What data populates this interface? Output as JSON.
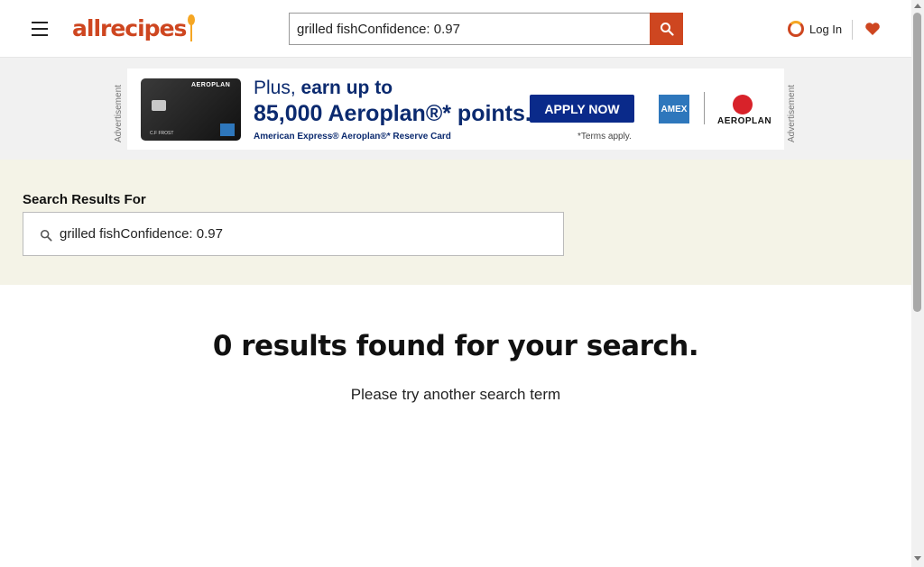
{
  "header": {
    "logo_text": "allrecipes",
    "search": {
      "value": "grilled fishConfidence: 0.97",
      "placeholder": ""
    },
    "login_label": "Log In",
    "icons": {
      "menu": "hamburger-menu-icon",
      "search": "search-icon",
      "account": "user-icon",
      "favorites": "heart-icon"
    }
  },
  "ad": {
    "label": "Advertisement",
    "card_brand": "AEROPLAN",
    "card_name": "C.F FROST",
    "line1_prefix": "Plus,",
    "line1_bold": "earn up to",
    "line2": "85,000 Aeroplan®* points.*",
    "line3": "American Express® Aeroplan®* Reserve Card",
    "apply_label": "APPLY NOW",
    "terms": "*Terms apply.",
    "amex_label": "AMEX",
    "aeroplan_label": "AEROPLAN"
  },
  "results": {
    "heading": "Search Results For",
    "query": "grilled fishConfidence: 0.97",
    "no_results_title": "0 results found for your search.",
    "no_results_sub": "Please try another search term"
  },
  "colors": {
    "brand": "#ce4620",
    "accent": "#f5a623",
    "results_band": "#f4f3e7"
  }
}
